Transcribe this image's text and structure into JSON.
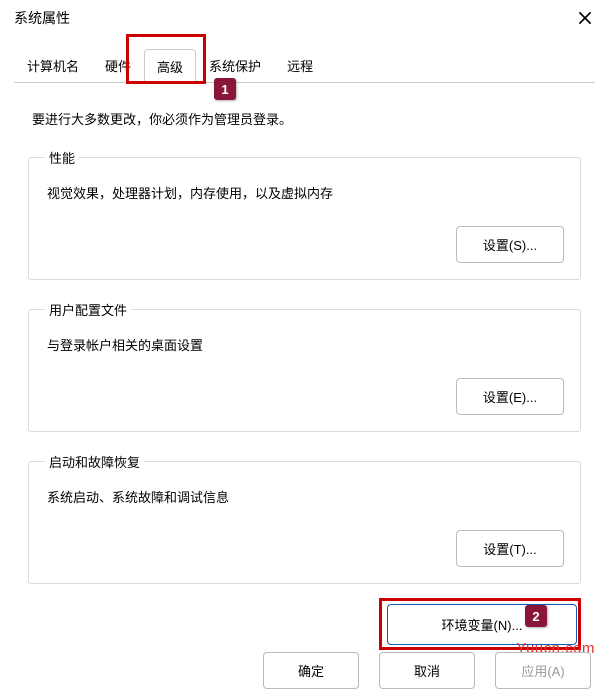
{
  "window": {
    "title": "系统属性"
  },
  "tabs": {
    "computer_name": "计算机名",
    "hardware": "硬件",
    "advanced": "高级",
    "system_protection": "系统保护",
    "remote": "远程"
  },
  "advanced_page": {
    "intro": "要进行大多数更改，你必须作为管理员登录。",
    "performance": {
      "legend": "性能",
      "desc": "视觉效果，处理器计划，内存使用，以及虚拟内存",
      "button": "设置(S)..."
    },
    "user_profiles": {
      "legend": "用户配置文件",
      "desc": "与登录帐户相关的桌面设置",
      "button": "设置(E)..."
    },
    "startup": {
      "legend": "启动和故障恢复",
      "desc": "系统启动、系统故障和调试信息",
      "button": "设置(T)..."
    },
    "env_button": "环境变量(N)..."
  },
  "footer": {
    "ok": "确定",
    "cancel": "取消",
    "apply": "应用(A)"
  },
  "markers": {
    "m1": "1",
    "m2": "2"
  },
  "watermark": "Yuucn.com"
}
